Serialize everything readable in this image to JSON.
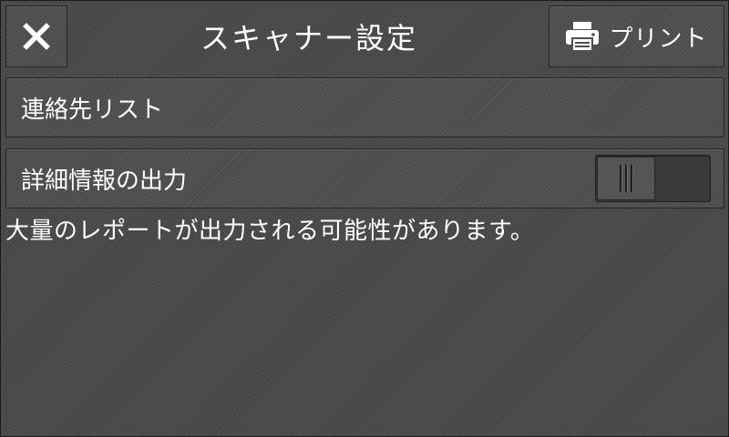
{
  "header": {
    "title": "スキャナー設定",
    "close_icon": "close-icon",
    "print_icon": "printer-icon",
    "print_label": "プリント"
  },
  "settings": {
    "contacts_label": "連絡先リスト",
    "details_label": "詳細情報の出力",
    "details_toggle_state": "off"
  },
  "notice": "大量のレポートが出力される可能性があります。"
}
